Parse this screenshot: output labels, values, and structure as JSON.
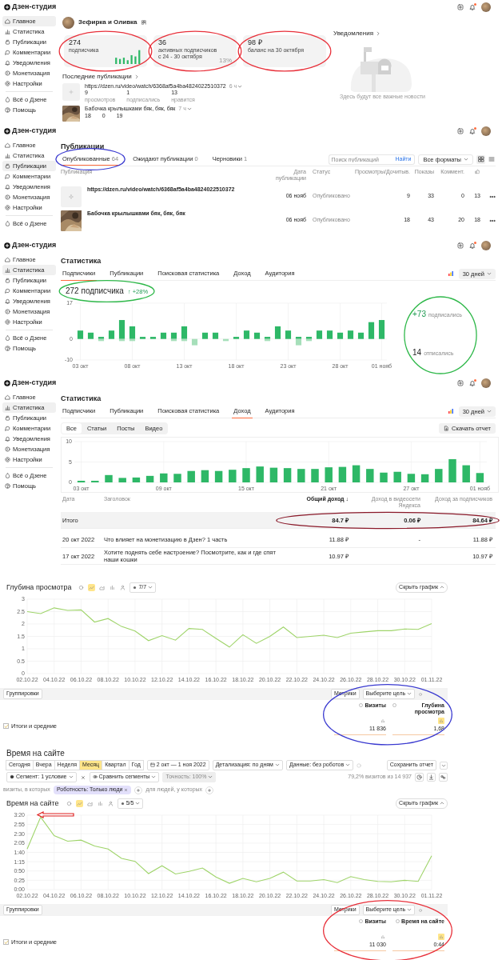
{
  "home_screen": {
    "header": {
      "logo": "Дзен-студия"
    },
    "sidebar": {
      "items": [
        {
          "label": "Главное",
          "kind": "home",
          "selected": true
        },
        {
          "label": "Статистика",
          "kind": "stats",
          "selected": false
        },
        {
          "label": "Публикации",
          "kind": "pubs",
          "selected": false
        },
        {
          "label": "Комментарии",
          "kind": "comments",
          "selected": false
        },
        {
          "label": "Уведомления",
          "kind": "bell",
          "selected": false
        },
        {
          "label": "Монетизация",
          "kind": "money",
          "selected": false
        },
        {
          "label": "Настройки",
          "kind": "settings",
          "selected": false
        }
      ],
      "footer_items": [
        {
          "label": "Всё о Дзене",
          "kind": "about"
        },
        {
          "label": "Помощь",
          "kind": "help"
        }
      ]
    },
    "channel": {
      "name": "Зефирка и Оливка"
    },
    "stat_cards": [
      {
        "kind": "bars",
        "value": "274",
        "label": "подписчика",
        "annotation": {
          "color": "#e8303a"
        }
      },
      {
        "kind": "percent",
        "value": "36",
        "label": "активных подписчиков",
        "sublabel": "с 24 - 30 октября",
        "percent": "13%",
        "annotation": {
          "color": "#e8303a"
        }
      },
      {
        "kind": "plain",
        "value": "98 ₽",
        "label": "баланс на 30 октября",
        "annotation": {
          "color": "#e8303a"
        }
      }
    ],
    "latest": {
      "title": "Последние публикации",
      "items": [
        {
          "kind": "video",
          "title": "https://dzen.ru/video/watch/6368af5a4ba4824022510372",
          "age": "6 ч",
          "stats": [
            {
              "value": "9",
              "label": "просмотров"
            },
            {
              "value": "1",
              "label": "подписались"
            },
            {
              "value": "13",
              "label": "нравится"
            }
          ]
        },
        {
          "kind": "picture",
          "title": "Бабочка крылышками бяк, бяк, бяк",
          "age": "7 ч",
          "stats": [
            {
              "value": "18"
            },
            {
              "value": "0"
            },
            {
              "value": "19"
            }
          ]
        }
      ]
    },
    "notifications": {
      "title": "Уведомления",
      "empty_text": "Здесь будут все важные новости"
    }
  },
  "publications_screen": {
    "header": {
      "logo": "Дзен-студия"
    },
    "sidebar": {
      "items": [
        {
          "label": "Главное",
          "kind": "home",
          "selected": false
        },
        {
          "label": "Статистика",
          "kind": "stats",
          "selected": false
        },
        {
          "label": "Публикации",
          "kind": "pubs",
          "selected": true
        },
        {
          "label": "Комментарии",
          "kind": "comments",
          "selected": false
        },
        {
          "label": "Уведомления",
          "kind": "bell",
          "selected": false
        },
        {
          "label": "Монетизация",
          "kind": "money",
          "selected": false
        },
        {
          "label": "Настройки",
          "kind": "settings",
          "selected": false
        }
      ],
      "footer_items": [
        {
          "label": "Всё о Дзене",
          "kind": "about"
        }
      ]
    },
    "title": "Публикации",
    "tabs": [
      {
        "label": "Опубликованные",
        "count": "64",
        "selected": true,
        "annotation": {
          "color": "#3a3ad0"
        }
      },
      {
        "label": "Ожидают публикации",
        "count": "0",
        "selected": false
      },
      {
        "label": "Черновики",
        "count": "1",
        "selected": false
      }
    ],
    "search": {
      "placeholder": "Поиск публикаций",
      "button": "Найти"
    },
    "format_select": "Все форматы",
    "columns": [
      "Публикация",
      "Дата публикации",
      "Статус",
      "Просмотры/Дочитыв.",
      "Показы",
      "Коммент."
    ],
    "rows": [
      {
        "kind": "video",
        "title": "https://dzen.ru/video/watch/6368af5a4ba4824022510372",
        "date": "06 нояб",
        "status": "Опубликовано",
        "views": "9",
        "impressions": "33",
        "comments": "0",
        "likes": "13"
      },
      {
        "kind": "picture",
        "title": "Бабочка крылышками бяк, бяк, бяк",
        "date": "06 нояб",
        "status": "Опубликовано",
        "views": "18",
        "impressions": "43",
        "comments": "20",
        "likes": "18"
      }
    ]
  },
  "subscribers_screen": {
    "header": {
      "logo": "Дзен-студия"
    },
    "sidebar": {
      "items": [
        {
          "label": "Главное",
          "kind": "home",
          "selected": false
        },
        {
          "label": "Статистика",
          "kind": "stats",
          "selected": true
        },
        {
          "label": "Публикации",
          "kind": "pubs",
          "selected": false
        },
        {
          "label": "Комментарии",
          "kind": "comments",
          "selected": false
        },
        {
          "label": "Уведомления",
          "kind": "bell",
          "selected": false
        },
        {
          "label": "Монетизация",
          "kind": "money",
          "selected": false
        },
        {
          "label": "Настройки",
          "kind": "settings",
          "selected": false
        }
      ],
      "footer_items": [
        {
          "label": "Всё о Дзене",
          "kind": "about"
        },
        {
          "label": "Помощь",
          "kind": "help"
        }
      ]
    },
    "title": "Статистика",
    "tabs": [
      {
        "label": "Подписчики",
        "selected": true
      },
      {
        "label": "Публикации",
        "selected": false
      },
      {
        "label": "Поисковая статистика",
        "selected": false
      },
      {
        "label": "Доход",
        "selected": false
      },
      {
        "label": "Аудитория",
        "selected": false
      }
    ],
    "period": "30 дней",
    "total": {
      "value": "272 подписчика",
      "growth": "↑ +28%",
      "annotation": {
        "color": "#2fb84a"
      }
    },
    "chart_data": {
      "type": "bar",
      "stacked": true,
      "grid": true,
      "ylim": [
        -10,
        17
      ],
      "yticks": [
        -10,
        0,
        17
      ],
      "categories": [
        "03 окт",
        null,
        null,
        null,
        null,
        "08 окт",
        null,
        null,
        null,
        null,
        "13 окт",
        null,
        null,
        null,
        null,
        "18 окт",
        null,
        null,
        null,
        null,
        "23 окт",
        null,
        null,
        null,
        null,
        "28 окт",
        null,
        null,
        null,
        "01 нояб"
      ],
      "series": [
        {
          "color": "#2eb867",
          "values": [
            4,
            3,
            1,
            4,
            9,
            6,
            1,
            1,
            3,
            3,
            6,
            0,
            3,
            3,
            0,
            1,
            4,
            3,
            1,
            6,
            4,
            1,
            1,
            4,
            4,
            3,
            4,
            3,
            8,
            9
          ]
        },
        {
          "color": "#a6dfba",
          "values": [
            0,
            0,
            -1,
            0,
            -1,
            -1,
            0,
            0,
            0,
            -1,
            -1,
            -3,
            0,
            0,
            -1,
            0,
            0,
            0,
            -1,
            0,
            0,
            -3,
            -1,
            0,
            0,
            0,
            0,
            0,
            0,
            0
          ]
        }
      ]
    },
    "summary": {
      "annotation": {
        "color": "#2fb84a"
      },
      "items": [
        {
          "kind": "gain",
          "value": "+73",
          "label": "подписались"
        },
        {
          "kind": "loss",
          "value": "14",
          "label": "отписались"
        }
      ]
    }
  },
  "income_screen": {
    "header": {
      "logo": "Дзен-студия"
    },
    "sidebar": {
      "items": [
        {
          "label": "Главное",
          "kind": "home",
          "selected": false
        },
        {
          "label": "Статистика",
          "kind": "stats",
          "selected": true
        },
        {
          "label": "Публикации",
          "kind": "pubs",
          "selected": false
        },
        {
          "label": "Комментарии",
          "kind": "comments",
          "selected": false
        },
        {
          "label": "Уведомления",
          "kind": "bell",
          "selected": false
        },
        {
          "label": "Монетизация",
          "kind": "money",
          "selected": false
        },
        {
          "label": "Настройки",
          "kind": "settings",
          "selected": false
        }
      ],
      "footer_items": [
        {
          "label": "Всё о Дзене",
          "kind": "about"
        },
        {
          "label": "Помощь",
          "kind": "help"
        }
      ]
    },
    "title": "Статистика",
    "tabs": [
      {
        "label": "Подписчики",
        "selected": false
      },
      {
        "label": "Публикации",
        "selected": false
      },
      {
        "label": "Поисковая статистика",
        "selected": false
      },
      {
        "label": "Доход",
        "selected": true
      },
      {
        "label": "Аудитория",
        "selected": false
      }
    ],
    "period": "30 дней",
    "filter_tabs": [
      {
        "label": "Все",
        "selected": true
      },
      {
        "label": "Статьи",
        "selected": false
      },
      {
        "label": "Посты",
        "selected": false
      },
      {
        "label": "Видео",
        "selected": false
      }
    ],
    "download_button": "Скачать отчет",
    "chart_data": {
      "type": "bar",
      "grid": true,
      "ylim": [
        0,
        10
      ],
      "yticks": [
        0,
        5,
        10
      ],
      "categories": [
        "03 окт",
        null,
        null,
        null,
        null,
        null,
        "09 окт",
        null,
        null,
        null,
        null,
        null,
        "15 окт",
        null,
        null,
        null,
        null,
        null,
        "21 окт",
        null,
        null,
        null,
        null,
        null,
        "27 окт",
        null,
        null,
        null,
        null,
        "01 нояб"
      ],
      "series": [
        {
          "color": "#2eb867",
          "values": [
            0.4,
            0.4,
            1.8,
            1.1,
            1.2,
            1.6,
            2.2,
            2.1,
            2.8,
            3,
            2.8,
            3.1,
            3.5,
            3.9,
            3.6,
            3.5,
            3.3,
            3.3,
            3.7,
            3.8,
            4.2,
            3.3,
            2.4,
            2.6,
            2.1,
            2,
            3.3,
            5.7,
            4.2,
            2.3
          ]
        }
      ]
    },
    "table": {
      "columns": [
        "Дата",
        "Заголовок",
        "Общий доход ↓",
        "Доход в видеосети Яндекса",
        "Доход за подписчиков"
      ],
      "total": {
        "label": "Итого",
        "total": "84.7 ₽",
        "video": "0.06 ₽",
        "subscribers": "84.64 ₽",
        "annotation": {
          "color": "#8a1a2a"
        }
      },
      "rows": [
        {
          "date": "20 окт 2022",
          "title": "Что влияет на монетизацию в Дзен? 1 часть",
          "total": "11.88 ₽",
          "video": "-",
          "subscribers": "11.88 ₽"
        },
        {
          "date": "17 окт 2022",
          "title": "Хотите поднять себе настроение? Посмотрите, как и где спят наши кошки",
          "total": "10.97 ₽",
          "subscribers": "10.97 ₽"
        }
      ]
    }
  },
  "depth_report": {
    "chart": {
      "title": "Глубина просмотра",
      "type_buttons": [
        {
          "kind": "pie",
          "selected": false
        },
        {
          "kind": "line",
          "selected": true
        },
        {
          "kind": "area",
          "selected": false
        },
        {
          "kind": "bar",
          "selected": false
        },
        {
          "kind": "person",
          "selected": false
        }
      ],
      "scale_select": "7/7",
      "hide_button": "Скрыть график",
      "chart_data": {
        "type": "line",
        "grid": true,
        "ylim": [
          0,
          3
        ],
        "yticks": [
          0,
          0.5,
          1,
          1.5,
          2,
          2.5,
          3
        ],
        "categories": [
          "02.10.22",
          null,
          "04.10.22",
          null,
          "06.10.22",
          null,
          "08.10.22",
          null,
          "10.10.22",
          null,
          "12.10.22",
          null,
          "14.10.22",
          null,
          "16.10.22",
          null,
          "18.10.22",
          null,
          "20.10.22",
          null,
          "22.10.22",
          null,
          "24.10.22",
          null,
          "26.10.22",
          null,
          "28.10.22",
          null,
          "30.10.22",
          null,
          "01.11.22"
        ],
        "series": [
          {
            "color": "#9fd46a",
            "values": [
              2.5,
              2.42,
              2.65,
              2.55,
              2.57,
              2.08,
              2.22,
              1.9,
              1.72,
              1.33,
              1.53,
              1.35,
              1.82,
              1.78,
              1.42,
              1.07,
              1.57,
              1.22,
              1.5,
              1.88,
              1.45,
              1.5,
              1.55,
              1.45,
              1.63,
              1.68,
              1.73,
              1.73,
              1.8,
              1.78,
              2.02
            ]
          }
        ]
      }
    },
    "grouping_button": "Группировки",
    "metrics_button": "Метрики",
    "goal_select": "Выберите цель",
    "metric_columns": [
      {
        "label": "Визиты",
        "selected": false,
        "total": "11 836"
      },
      {
        "label": "Глубина просмотра",
        "selected": true,
        "total": "1,68"
      }
    ],
    "totals_checkbox": {
      "label": "Итоги и средние",
      "checked": true
    },
    "annotation": {
      "color": "#3a3ad0"
    }
  },
  "time_report": {
    "title": "Время на сайте",
    "visits_info": "79,2% визитов из 14 937",
    "save_button": "Сохранить отчет",
    "period_buttons": [
      {
        "label": "Сегодня",
        "selected": false
      },
      {
        "label": "Вчера",
        "selected": false
      },
      {
        "label": "Неделя",
        "selected": false
      },
      {
        "label": "Месяц",
        "selected": true
      },
      {
        "label": "Квартал",
        "selected": false
      },
      {
        "label": "Год",
        "selected": false
      }
    ],
    "date_range": "2 окт — 1 ноя 2022",
    "detail_select": "Детализация: по дням",
    "data_select": "Данные: без роботов",
    "segment_button": "Сегмент: 1 условие",
    "compare_button": "Сравнить сегменты",
    "accuracy_select": {
      "label": "Точность: 100%",
      "disabled": true
    },
    "filter": {
      "prefix": "визиты, в которых",
      "chip": "Роботность: Только люди",
      "suffix": "для людей, у которых"
    },
    "chart": {
      "title": "Время на сайте",
      "type_buttons": [
        {
          "kind": "pie",
          "selected": false
        },
        {
          "kind": "line",
          "selected": true
        },
        {
          "kind": "area",
          "selected": false
        },
        {
          "kind": "bar",
          "selected": false
        },
        {
          "kind": "person",
          "selected": false
        }
      ],
      "scale_select": "5/5",
      "hide_button": "Скрыть график",
      "arrow": {
        "color": "#e02020"
      },
      "chart_data": {
        "type": "line",
        "grid": true,
        "ylim": [
          0,
          200
        ],
        "yticks": [
          {
            "value": 0,
            "label": "0:00"
          },
          {
            "value": 25,
            "label": "0:25"
          },
          {
            "value": 50,
            "label": "0:50"
          },
          {
            "value": 75,
            "label": "1:15"
          },
          {
            "value": 100,
            "label": "1:40"
          },
          {
            "value": 125,
            "label": "2:05"
          },
          {
            "value": 150,
            "label": "2:30"
          },
          {
            "value": 175,
            "label": "2:55"
          },
          {
            "value": 200,
            "label": "3:20"
          }
        ],
        "categories": [
          "02.10.22",
          null,
          "04.10.22",
          null,
          "06.10.22",
          null,
          "08.10.22",
          null,
          "10.10.22",
          null,
          "12.10.22",
          null,
          "14.10.22",
          null,
          "16.10.22",
          null,
          "18.10.22",
          null,
          "20.10.22",
          null,
          "22.10.22",
          null,
          "24.10.22",
          null,
          "26.10.22",
          null,
          "28.10.22",
          null,
          "30.10.22",
          null,
          "01.11.22"
        ],
        "series": [
          {
            "color": "#9fd46a",
            "values": [
              109,
              195,
              145,
              130,
              133,
              117,
              109,
              84,
              76,
              43,
              64,
              42,
              49,
              58,
              34,
              17,
              30,
              21,
              30,
              47,
              23,
              23,
              27,
              19,
              35,
              27,
              22,
              21,
              25,
              22,
              91
            ]
          }
        ]
      }
    },
    "grouping_button": "Группировки",
    "metrics_button": "Метрики",
    "goal_select": "Выберите цель",
    "metric_columns": [
      {
        "label": "Визиты",
        "selected": false,
        "total": "11 030"
      },
      {
        "label": "Время на сайте",
        "selected": true,
        "total": "0:44"
      }
    ],
    "totals_checkbox": {
      "label": "Итоги и средние",
      "checked": true
    },
    "annotation": {
      "color": "#e8303a"
    }
  }
}
